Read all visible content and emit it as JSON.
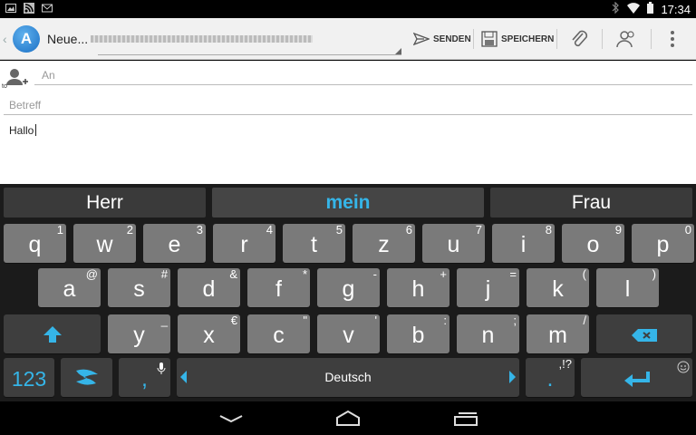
{
  "status_bar": {
    "time": "17:34",
    "left_icons": [
      "gallery-icon",
      "rss-icon",
      "gmail-icon"
    ],
    "right_icons": [
      "bluetooth-icon",
      "wifi-icon",
      "battery-icon"
    ]
  },
  "action_bar": {
    "title": "Neue...",
    "send_label": "SENDEN",
    "save_label": "SPEICHERN",
    "icons": [
      "attachment-icon",
      "contacts-icon",
      "overflow-menu-icon"
    ]
  },
  "compose": {
    "to_small_label": "to",
    "to_placeholder": "An",
    "subject_placeholder": "Betreff",
    "body_text": "Hallo"
  },
  "keyboard": {
    "suggestions": [
      "Herr",
      "mein",
      "Frau"
    ],
    "row1": [
      {
        "key": "q",
        "hint": "1"
      },
      {
        "key": "w",
        "hint": "2"
      },
      {
        "key": "e",
        "hint": "3"
      },
      {
        "key": "r",
        "hint": "4"
      },
      {
        "key": "t",
        "hint": "5"
      },
      {
        "key": "z",
        "hint": "6"
      },
      {
        "key": "u",
        "hint": "7"
      },
      {
        "key": "i",
        "hint": "8"
      },
      {
        "key": "o",
        "hint": "9"
      },
      {
        "key": "p",
        "hint": "0"
      }
    ],
    "row2": [
      {
        "key": "a",
        "hint": "@"
      },
      {
        "key": "s",
        "hint": "#"
      },
      {
        "key": "d",
        "hint": "&"
      },
      {
        "key": "f",
        "hint": "*"
      },
      {
        "key": "g",
        "hint": "-"
      },
      {
        "key": "h",
        "hint": "+"
      },
      {
        "key": "j",
        "hint": "="
      },
      {
        "key": "k",
        "hint": "("
      },
      {
        "key": "l",
        "hint": ")"
      }
    ],
    "row3": [
      {
        "key": "y",
        "hint": "_"
      },
      {
        "key": "x",
        "hint": "€"
      },
      {
        "key": "c",
        "hint": "\""
      },
      {
        "key": "v",
        "hint": "'"
      },
      {
        "key": "b",
        "hint": ":"
      },
      {
        "key": "n",
        "hint": ";"
      },
      {
        "key": "m",
        "hint": "/"
      }
    ],
    "numbers_label": "123",
    "comma_label": ",",
    "space_label": "Deutsch",
    "period_label": ".",
    "period_hint": ",!?",
    "accent_color": "#35b5e8"
  },
  "nav_bar": {
    "icons": [
      "back-icon",
      "home-icon",
      "recents-icon"
    ]
  }
}
